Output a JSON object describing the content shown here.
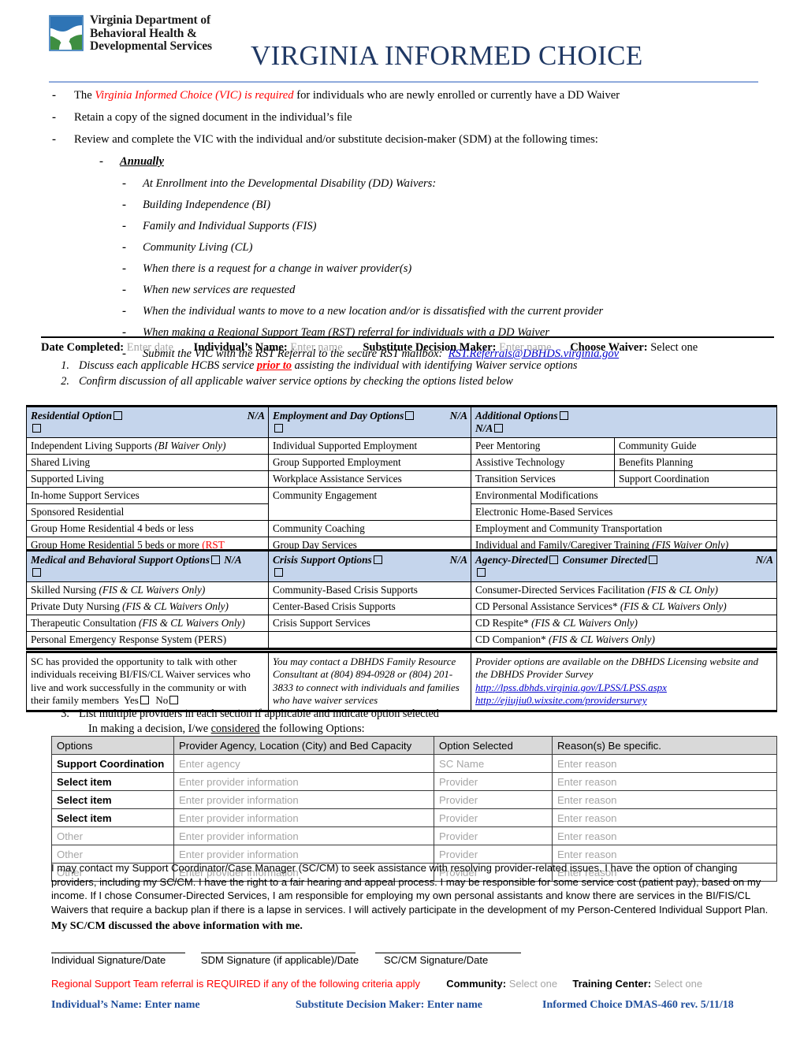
{
  "header": {
    "logo_lines": [
      "Virginia Department of",
      "Behavioral Health &",
      "Developmental Services"
    ],
    "title": "VIRGINIA INFORMED CHOICE"
  },
  "intro_bullets": [
    {
      "pre": "The ",
      "em": "Virginia Informed Choice (VIC) is required",
      "post": " for individuals who are newly enrolled or currently have a DD Waiver"
    },
    {
      "pre": "Retain a copy of the signed document in the individual’s file",
      "em": "",
      "post": ""
    },
    {
      "pre": "Review and complete the VIC with the individual and/or substitute decision-maker (SDM) at the following times:",
      "em": "",
      "post": ""
    }
  ],
  "annually_label": "Annually",
  "sub_bullets": [
    "At Enrollment into the Developmental Disability (DD) Waivers:",
    "Building Independence (BI)",
    "Family and Individual Supports (FIS)",
    "Community Living (CL)",
    "When there is a request for a change in waiver provider(s)",
    "When new services are requested",
    "When the individual wants to move to a new location and/or is dissatisfied with the current provider",
    "When making a Regional Support Team (RST) referral for individuals with a DD Waiver"
  ],
  "rst_mailbox": {
    "text": "Submit the VIC with the RST Referral to the secure RST mailbox:",
    "email": "RST.Referrals@DBHDS.virginia.gov"
  },
  "info_line": {
    "date_label": "Date Completed:",
    "date_value": "Enter date",
    "name_label": "Individual’s Name:",
    "name_value": "Enter name",
    "sdm_label": "Substitute Decision Maker:",
    "sdm_value": "Enter name",
    "waiver_label": "Choose Waiver:",
    "waiver_value": "Select one"
  },
  "numbered": [
    {
      "num": "1.",
      "pre": "Discuss each applicable HCBS service ",
      "em": "prior to",
      "post": " assisting the individual with identifying Waiver service options"
    },
    {
      "num": "2.",
      "pre": "Confirm discussion of all applicable waiver service options by checking the options listed below",
      "em": "",
      "post": ""
    }
  ],
  "options_table_1": {
    "headers": [
      {
        "label": "Residential Option",
        "na": "N/A"
      },
      {
        "label": "Employment and Day Options",
        "na": "N/A"
      },
      {
        "label": "Additional Options",
        "na": "N/A"
      }
    ],
    "rows": [
      {
        "c1": "Independent Living Supports",
        "c1_it": " (BI Waiver Only)",
        "c2": "Individual Supported Employment",
        "c3": "Peer Mentoring",
        "c4": "Community Guide"
      },
      {
        "c1": "Shared Living",
        "c1_it": "",
        "c2": "Group Supported Employment",
        "c3": "Assistive Technology",
        "c4": "Benefits Planning"
      },
      {
        "c1": "Supported Living",
        "c1_it": "",
        "c2": "Workplace Assistance Services",
        "c3": "Transition Services",
        "c4": "Support Coordination"
      },
      {
        "c1": "In-home Support Services",
        "c1_it": "",
        "c2": "Community Engagement",
        "c3": "Environmental Modifications",
        "c4": null
      },
      {
        "c1": "Sponsored Residential",
        "c1_it": "",
        "c2": null,
        "c3": "Electronic Home-Based Services",
        "c4": null
      },
      {
        "c1": "Group Home Residential 4 beds or less",
        "c1_it": "",
        "c2": "Community Coaching",
        "c3": "Employment and Community Transportation",
        "c4": null
      },
      {
        "c1": "Group Home Residential 5 beds or more",
        "c1_red": " (RST required)",
        "c1_it": "",
        "c2": "Group Day Services",
        "c3": "Individual and Family/Caregiver Training",
        "c3_it": " (FIS Waiver Only)",
        "c4": null
      }
    ]
  },
  "options_table_2": {
    "headers": [
      {
        "label": "Medical and Behavioral Support Options",
        "na": "N/A"
      },
      {
        "label": "Crisis Support Options",
        "na": "N/A"
      },
      {
        "label": "Agency-Directed",
        "label2": "Consumer Directed",
        "na": "N/A"
      }
    ],
    "rows": [
      {
        "c1": "Skilled Nursing",
        "c1_it": " (FIS & CL Waivers Only)",
        "c2": "Community-Based Crisis Supports",
        "c3": "Consumer-Directed Services Facilitation",
        "c3_it": " (FIS & CL Only)"
      },
      {
        "c1": "Private Duty Nursing",
        "c1_it": " (FIS & CL Waivers Only)",
        "c2": "Center-Based Crisis Supports",
        "c3": "CD Personal Assistance Services*",
        "c3_it": " (FIS & CL Waivers Only)"
      },
      {
        "c1": "Therapeutic Consultation",
        "c1_it": " (FIS & CL Waivers Only)",
        "c2": "Crisis Support Services",
        "c3": "CD Respite*",
        "c3_it": " (FIS & CL Waivers Only)"
      },
      {
        "c1": "Personal Emergency Response System (PERS)",
        "c1_it": "",
        "c2": "",
        "c3": "CD Companion*",
        "c3_it": " (FIS & CL Waivers Only)"
      }
    ]
  },
  "contact_row": {
    "col1": "SC has provided the opportunity to talk with other individuals receiving BI/FIS/CL Waiver services who live and work successfully in the community or with their family members",
    "col1_yes": "Yes",
    "col1_no": "No",
    "col2": "You may contact a DBHDS Family Resource Consultant at (804) 894-0928 or (804) 201-3833 to connect with individuals and families who have waiver services",
    "col3": "Provider options are available on the DBHDS Licensing website and the DBHDS Provider Survey",
    "col3_link1": "http://lpss.dbhds.virginia.gov/LPSS/LPSS.aspx",
    "col3_link2": "http://ejiujiu0.wixsite.com/providersurvey"
  },
  "item3": {
    "num": "3.",
    "line1": "List multiple providers in each section if applicable and indicate option selected",
    "line2_pre": "In making a decision, I/we ",
    "line2_em": "considered",
    "line2_post": " the following Options:"
  },
  "provider_table": {
    "headers": [
      "Options",
      "Provider Agency, Location (City) and Bed Capacity",
      "Option Selected",
      "Reason(s) Be specific."
    ],
    "rows": [
      {
        "option": "Support Coordination",
        "option_style": "bold",
        "agency": "Enter agency",
        "selected": "SC Name",
        "reason": "Enter reason"
      },
      {
        "option": "Select item",
        "option_style": "bold",
        "agency": "Enter provider information",
        "selected": "Provider",
        "reason": "Enter reason"
      },
      {
        "option": "Select item",
        "option_style": "bold",
        "agency": "Enter provider information",
        "selected": "Provider",
        "reason": "Enter reason"
      },
      {
        "option": "Select item",
        "option_style": "bold",
        "agency": "Enter provider information",
        "selected": "Provider",
        "reason": "Enter reason"
      },
      {
        "option": "Other",
        "option_style": "grey",
        "agency": "Enter provider information",
        "selected": "Provider",
        "reason": "Enter reason"
      },
      {
        "option": "Other",
        "option_style": "grey",
        "agency": "Enter provider information",
        "selected": "Provider",
        "reason": "Enter reason"
      },
      {
        "option": "Other",
        "option_style": "grey",
        "agency": "Enter provider information",
        "selected": "Provider",
        "reason": "Enter reason"
      }
    ]
  },
  "closing_paragraph": "I may contact my Support Coordinator/Case Manager (SC/CM) to seek assistance with resolving provider-related issues.  I have the option of changing providers, including my SC/CM. I have the right to a fair hearing and appeal process.  I may be responsible for some service cost (patient pay), based on my income. If I chose Consumer-Directed Services, I am responsible for employing my own personal assistants and know there are services in the BI/FIS/CL Waivers that require a backup plan if there is a lapse in services. I will actively participate in the development of my Person-Centered Individual Support Plan.",
  "sc_discussed": "My SC/CM discussed the above information with me.",
  "signatures": [
    "Individual Signature/Date",
    "SDM Signature (if applicable)/Date",
    "SC/CM Signature/Date"
  ],
  "rst_footer": {
    "red_text": "Regional Support Team referral is REQUIRED if any of the following criteria apply",
    "community_label": "Community:",
    "community_value": "Select one",
    "training_label": "Training Center:",
    "training_value": "Select one"
  },
  "footer": {
    "name_label": "Individual’s Name:",
    "name_value": "Enter name",
    "sdm_label": "Substitute Decision Maker:",
    "sdm_value": "Enter name",
    "doc_ref": "Informed Choice DMAS-460 rev. 5/11/18"
  },
  "colors": {
    "title_blue": "#1F3864",
    "rule_blue": "#8FAADC",
    "table_header_blue": "#C5D5EC",
    "provider_header_grey": "#D9D9D9",
    "accent_red": "#FF0000",
    "footer_blue": "#1F4E9C",
    "placeholder_grey": "#A6A6A6"
  }
}
